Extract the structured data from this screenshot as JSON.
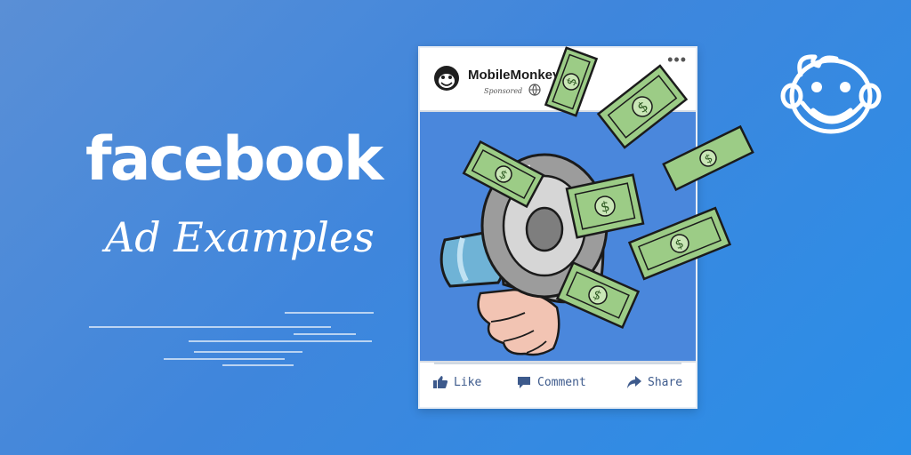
{
  "headline": {
    "brand": "facebook",
    "subtitle": "Ad Examples"
  },
  "post": {
    "page_name": "MobileMonkey",
    "sponsored_label": "Sponsored",
    "more_glyph": "•••",
    "actions": [
      {
        "label": "Like",
        "icon": "thumbs-up-icon"
      },
      {
        "label": "Comment",
        "icon": "comment-icon"
      },
      {
        "label": "Share",
        "icon": "share-arrow-icon"
      }
    ]
  },
  "colors": {
    "background_start": "#5a8fd6",
    "background_end": "#2a8ee8",
    "post_image_bg": "#4a87dc",
    "action_text": "#3d5a8c",
    "cash_green": "#8fbf7a"
  },
  "illustration": {
    "subject": "megaphone-icon",
    "items": "dollar-bill-icon"
  }
}
